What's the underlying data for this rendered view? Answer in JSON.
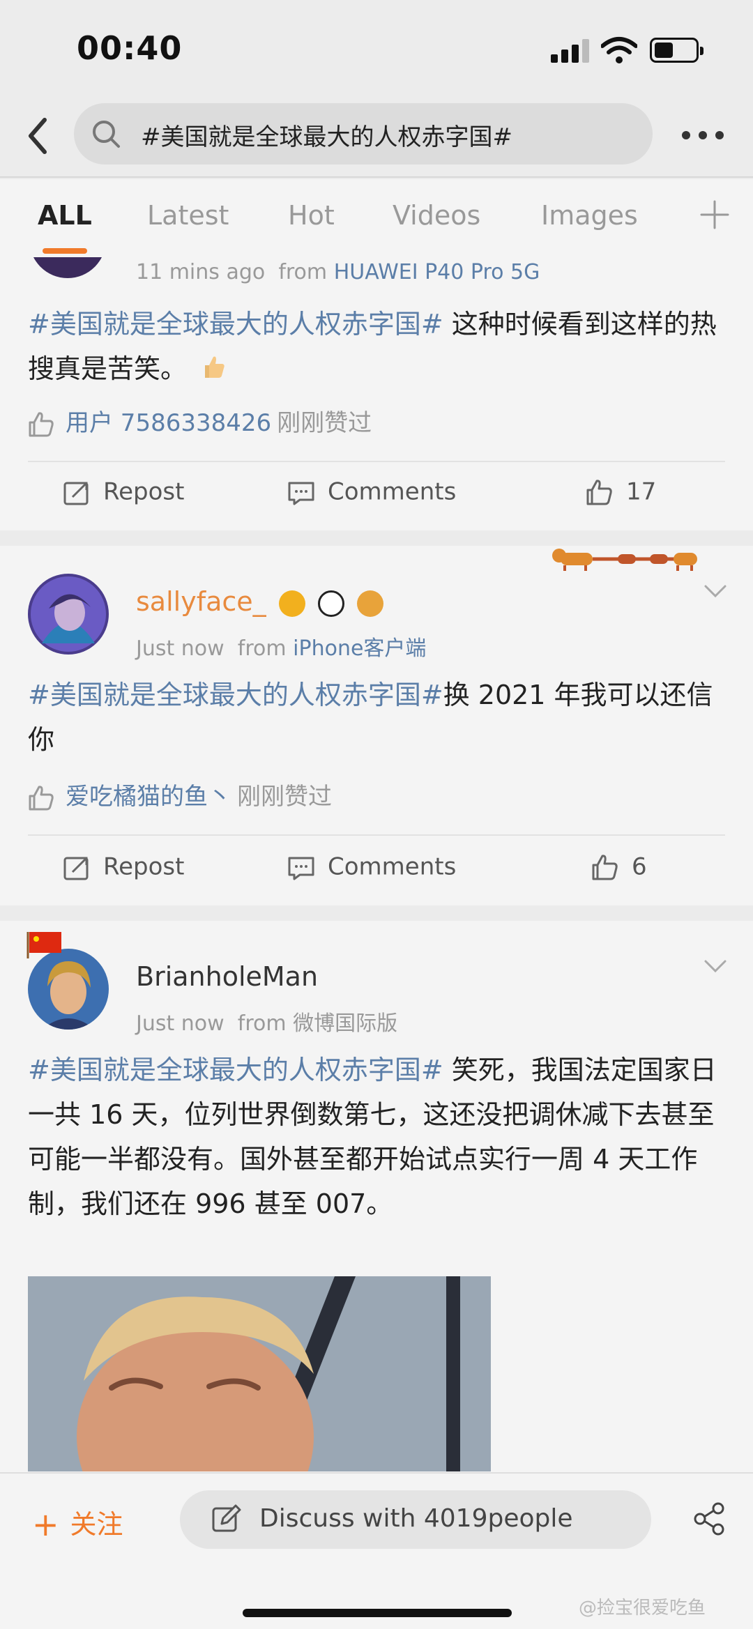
{
  "status_bar": {
    "time": "00:40"
  },
  "search": {
    "query": "#美国就是全球最大的人权赤字国#"
  },
  "tabs": [
    {
      "label": "ALL",
      "active": true
    },
    {
      "label": "Latest",
      "active": false
    },
    {
      "label": "Hot",
      "active": false
    },
    {
      "label": "Videos",
      "active": false
    },
    {
      "label": "Images",
      "active": false
    }
  ],
  "posts": [
    {
      "time": "11 mins ago",
      "from_prefix": "from",
      "source": "HUAWEI P40 Pro 5G",
      "hashtag": "#美国就是全球最大的人权赤字国#",
      "text": " 这种时候看到这样的热搜真是苦笑。",
      "liked_by": "用户 7586338426",
      "liked_suffix": "刚刚赞过",
      "repost_label": "Repost",
      "comments_label": "Comments",
      "like_count": "17"
    },
    {
      "username": "sallyface_",
      "time": "Just now",
      "from_prefix": "from",
      "source": "iPhone客户端",
      "hashtag": "#美国就是全球最大的人权赤字国#",
      "text": "换 2021 年我可以还信你",
      "liked_by": "爱吃橘猫的鱼丶",
      "liked_suffix": "刚刚赞过",
      "repost_label": "Repost",
      "comments_label": "Comments",
      "like_count": "6"
    },
    {
      "username": "BrianholeMan",
      "time": "Just now",
      "from_prefix": "from",
      "source": "微博国际版",
      "hashtag": "#美国就是全球最大的人权赤字国#",
      "text": " 笑死，我国法定国家日一共 16 天，位列世界倒数第七，这还没把调休减下去甚至可能一半都没有。国外甚至都开始试点实行一周 4 天工作制，我们还在 996 甚至 007。"
    }
  ],
  "bottom_bar": {
    "follow_label": "关注",
    "discuss_label": "Discuss with 4019people"
  },
  "watermark": "@捡宝很爱吃鱼",
  "colors": {
    "accent": "#f07a2a",
    "link": "#5b7ea8",
    "background": "#f4f4f4"
  }
}
